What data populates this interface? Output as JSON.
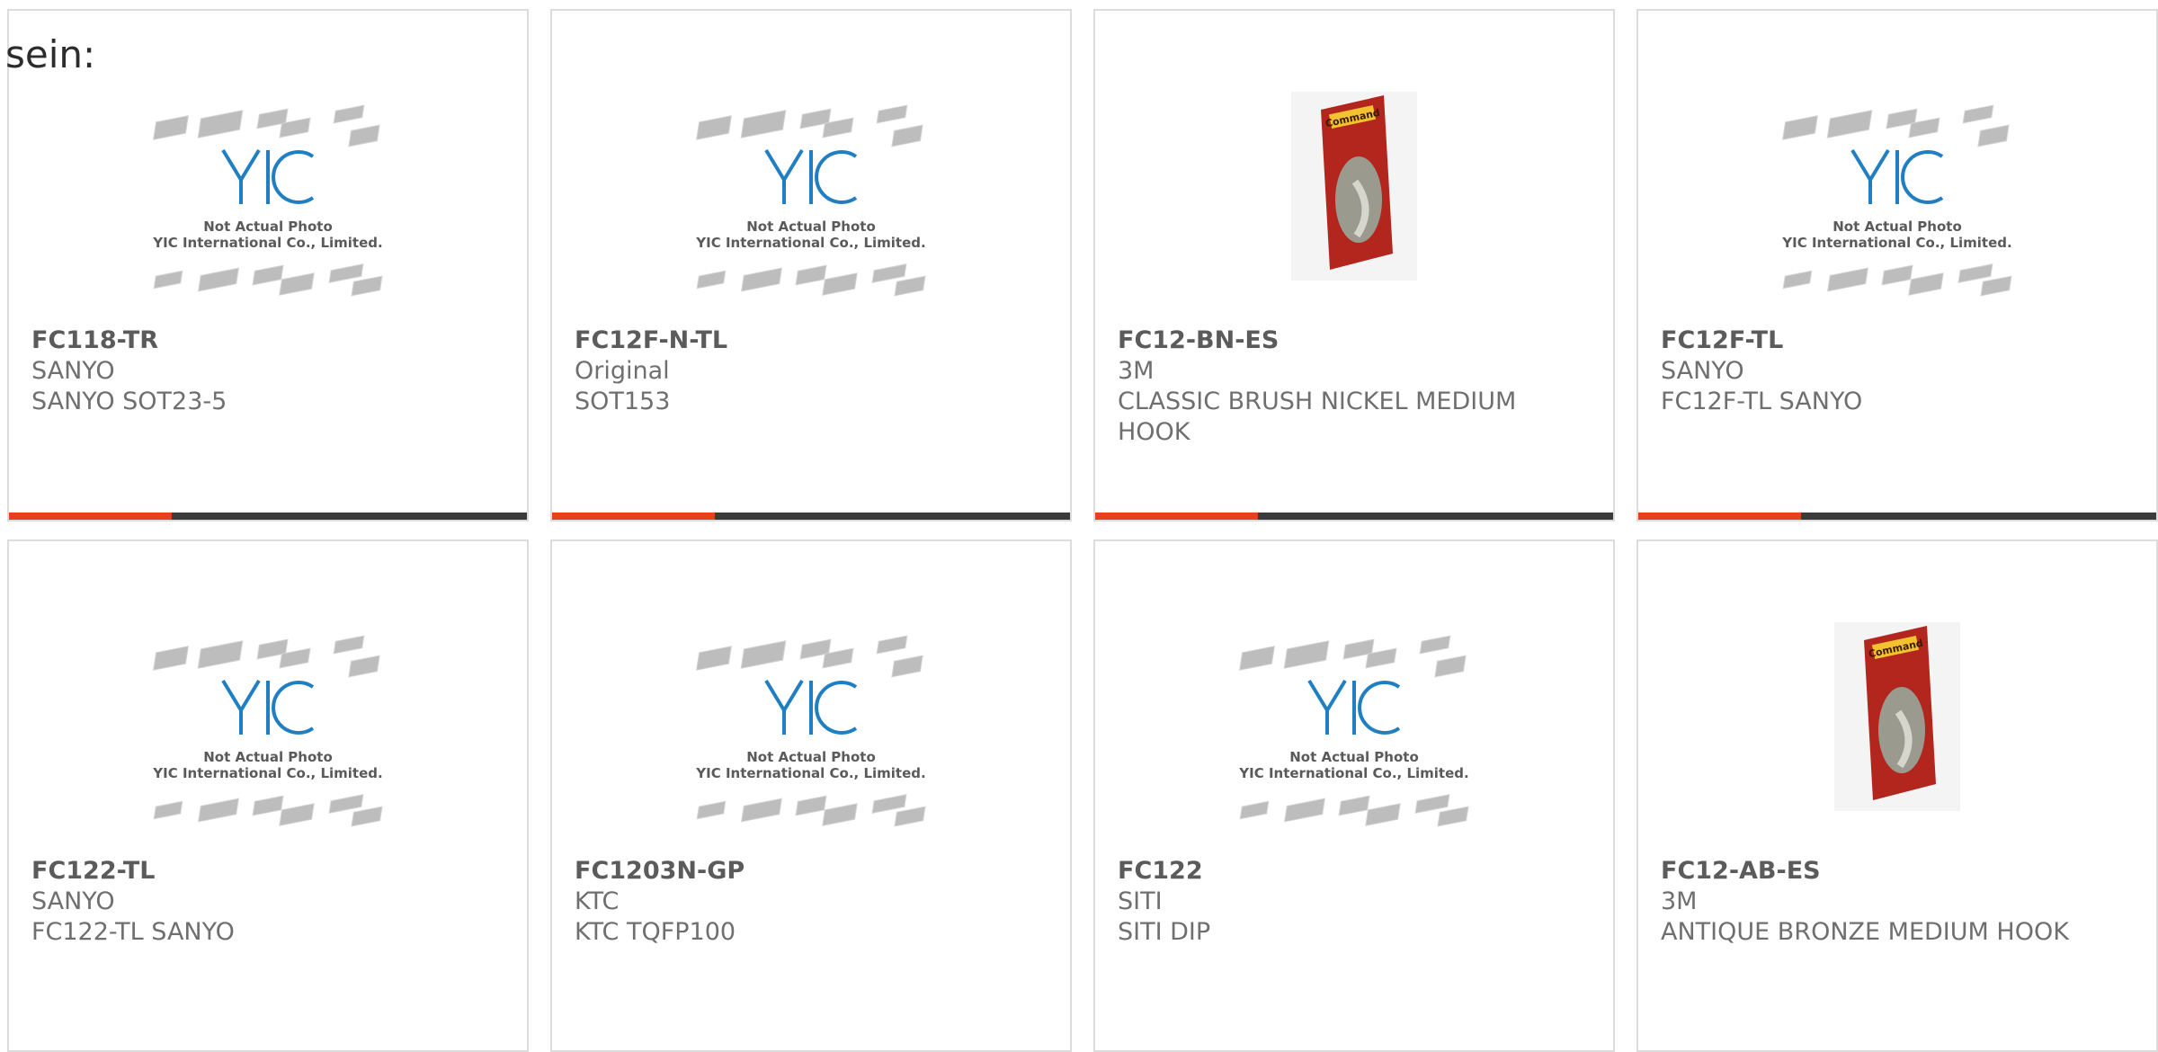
{
  "fragment_text": "sein:",
  "products": [
    {
      "pn": "FC118-TR",
      "brand": "SANYO",
      "desc": "SANYO SOT23-5",
      "image": "placeholder",
      "placeholder_line1": "Not Actual Photo",
      "placeholder_line2": "YIC International Co., Limited."
    },
    {
      "pn": "FC12F-N-TL",
      "brand": "Original",
      "desc": "SOT153",
      "image": "placeholder",
      "placeholder_line1": "Not Actual Photo",
      "placeholder_line2": "YIC International Co., Limited."
    },
    {
      "pn": "FC12-BN-ES",
      "brand": "3M",
      "desc": "CLASSIC BRUSH NICKEL MEDIUM HOOK",
      "image": "hook",
      "pack_brand": "Command"
    },
    {
      "pn": "FC12F-TL",
      "brand": "SANYO",
      "desc": "FC12F-TL SANYO",
      "image": "placeholder",
      "placeholder_line1": "Not Actual Photo",
      "placeholder_line2": "YIC International Co., Limited."
    },
    {
      "pn": "FC122-TL",
      "brand": "SANYO",
      "desc": "FC122-TL SANYO",
      "image": "placeholder",
      "placeholder_line1": "Not Actual Photo",
      "placeholder_line2": "YIC International Co., Limited."
    },
    {
      "pn": "FC1203N-GP",
      "brand": "KTC",
      "desc": "KTC TQFP100",
      "image": "placeholder",
      "placeholder_line1": "Not Actual Photo",
      "placeholder_line2": "YIC International Co., Limited."
    },
    {
      "pn": "FC122",
      "brand": "SITI",
      "desc": "SITI DIP",
      "image": "placeholder",
      "placeholder_line1": "Not Actual Photo",
      "placeholder_line2": "YIC International Co., Limited."
    },
    {
      "pn": "FC12-AB-ES",
      "brand": "3M",
      "desc": "ANTIQUE BRONZE MEDIUM HOOK",
      "image": "hook",
      "pack_brand": "Command"
    }
  ],
  "colors": {
    "accent": "#e8401c",
    "bar": "#3b3b3b",
    "logo": "#1f7fc2",
    "border": "#dcdcdc"
  }
}
